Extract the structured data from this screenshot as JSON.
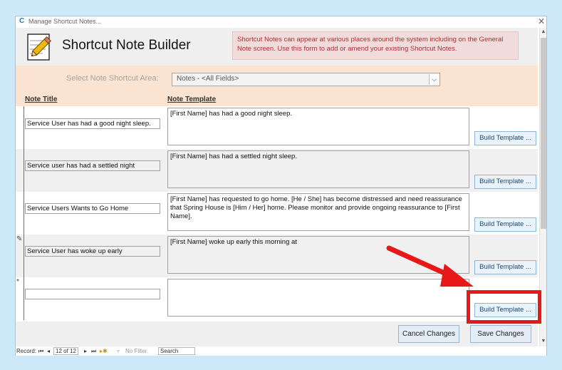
{
  "window": {
    "title": "Manage Shortcut Notes...",
    "app_icon_glyph": "C",
    "close_glyph": "✕"
  },
  "header": {
    "title": "Shortcut Note Builder",
    "info_text": "Shortcut Notes can appear at various places around the system including on the General Note screen.  Use this form to add or amend your existing Shortcut Notes."
  },
  "area": {
    "label": "Select Note Shortcut Area:",
    "selected_value": "Notes - <All Fields>",
    "dropdown_icon": "chevron-down-icon"
  },
  "columns": {
    "title": "Note Title",
    "template": "Note Template"
  },
  "rows": [
    {
      "selector_glyph": "",
      "title": "Service User has had a good night sleep.",
      "template": "[First Name] has had a good night sleep.",
      "build_label": "Build Template ..."
    },
    {
      "selector_glyph": "",
      "title": "Service user has had a settled night",
      "template": "[First Name] has had a settled night sleep.",
      "build_label": "Build Template ..."
    },
    {
      "selector_glyph": "",
      "title": "Service Users Wants to Go Home",
      "template": "[First Name] has requested to go home. [He / She] has become distressed and need reassurance that Spring House is [Him / Her] home.  Please monitor and provide ongoing reassurance to [First Name].",
      "build_label": "Build Template ..."
    },
    {
      "selector_glyph": "✎",
      "title": "Service User has woke up early",
      "template": "[First Name] woke up early this morning at",
      "build_label": "Build Template ..."
    },
    {
      "selector_glyph": "*",
      "title": "",
      "template": "",
      "build_label": "Build Template ..."
    }
  ],
  "footer": {
    "cancel_label": "Cancel Changes",
    "save_label": "Save Changes"
  },
  "record_nav": {
    "record_label": "Record:",
    "first_glyph": "⏮",
    "prev_glyph": "◂",
    "position": "12 of 12",
    "next_glyph": "▸",
    "last_glyph": "⏭",
    "new_glyph": "▸✱",
    "filter_label": "No Filter",
    "search_label": "Search"
  },
  "colors": {
    "highlight_red": "#e81818",
    "info_text": "#b03030",
    "area_band": "#fae3d0"
  }
}
